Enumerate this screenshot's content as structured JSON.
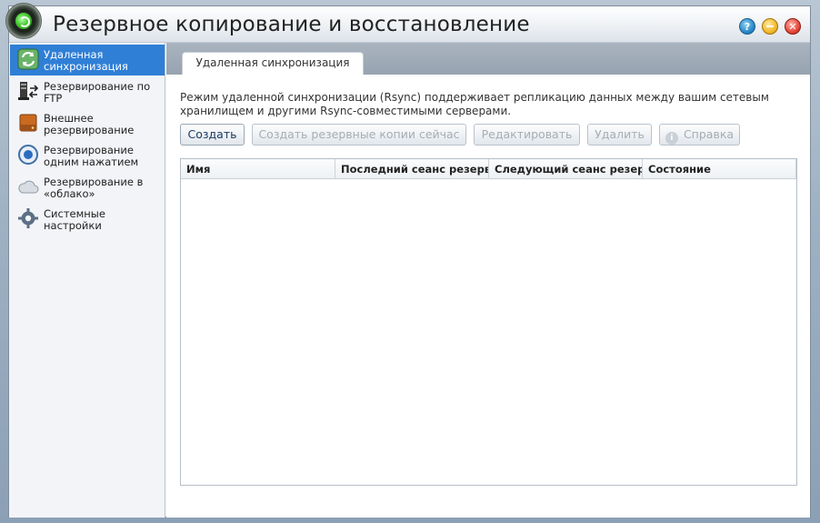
{
  "window": {
    "title": "Резервное копирование и восстановление",
    "buttons": {
      "help": "?",
      "minimize": "",
      "close": "✕"
    }
  },
  "sidebar": {
    "items": [
      {
        "label": "Удаленная синхронизация",
        "icon": "sync-icon",
        "active": true
      },
      {
        "label": "Резервирование по FTP",
        "icon": "ftp-icon",
        "active": false
      },
      {
        "label": "Внешнее резервирование",
        "icon": "external-drive-icon",
        "active": false
      },
      {
        "label": "Резервирование одним нажатием",
        "icon": "one-touch-icon",
        "active": false
      },
      {
        "label": "Резервирование в «облако»",
        "icon": "cloud-icon",
        "active": false
      },
      {
        "label": "Системные настройки",
        "icon": "settings-gear-icon",
        "active": false
      }
    ]
  },
  "main": {
    "tab_label": "Удаленная синхронизация",
    "description": "Режим удаленной синхронизации (Rsync) поддерживает репликацию данных между вашим сетевым хранилищем и другими Rsync-совместимыми серверами.",
    "toolbar": {
      "create": "Создать",
      "backup_now": "Создать резервные копии сейчас",
      "edit": "Редактировать",
      "delete": "Удалить",
      "help": "Справка"
    },
    "table": {
      "columns": [
        "Имя",
        "Последний сеанс резерв",
        "Следующий сеанс резер",
        "Состояние"
      ],
      "rows": []
    }
  },
  "colors": {
    "accent": "#2f7fd6",
    "tabstrip": "#a0acb8",
    "disabled_text": "#a6adb4"
  }
}
